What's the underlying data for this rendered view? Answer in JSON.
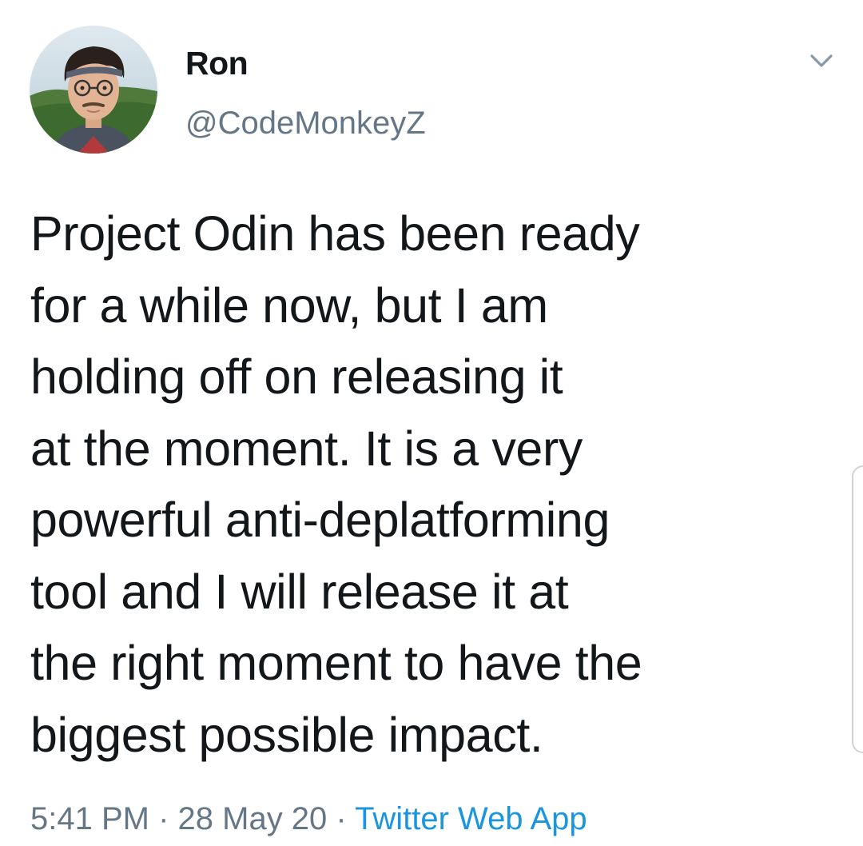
{
  "tweet": {
    "display_name": "Ron",
    "handle": "@CodeMonkeyZ",
    "text_lines": [
      "Project Odin has been ready",
      "for a while now, but I am",
      "holding off on releasing it",
      "at the moment. It is a very",
      "powerful anti-deplatforming",
      "tool and I will release it at",
      "the right moment to have the",
      "biggest possible impact."
    ],
    "time": "5:41 PM",
    "separator": " · ",
    "date": "28 May 20",
    "source": "Twitter Web App"
  },
  "icons": {
    "menu_caret": "chevron-down-icon",
    "avatar": "profile-photo"
  },
  "colors": {
    "text": "#14171a",
    "secondary": "#657786",
    "link": "#1b95e0",
    "background": "#ffffff"
  }
}
